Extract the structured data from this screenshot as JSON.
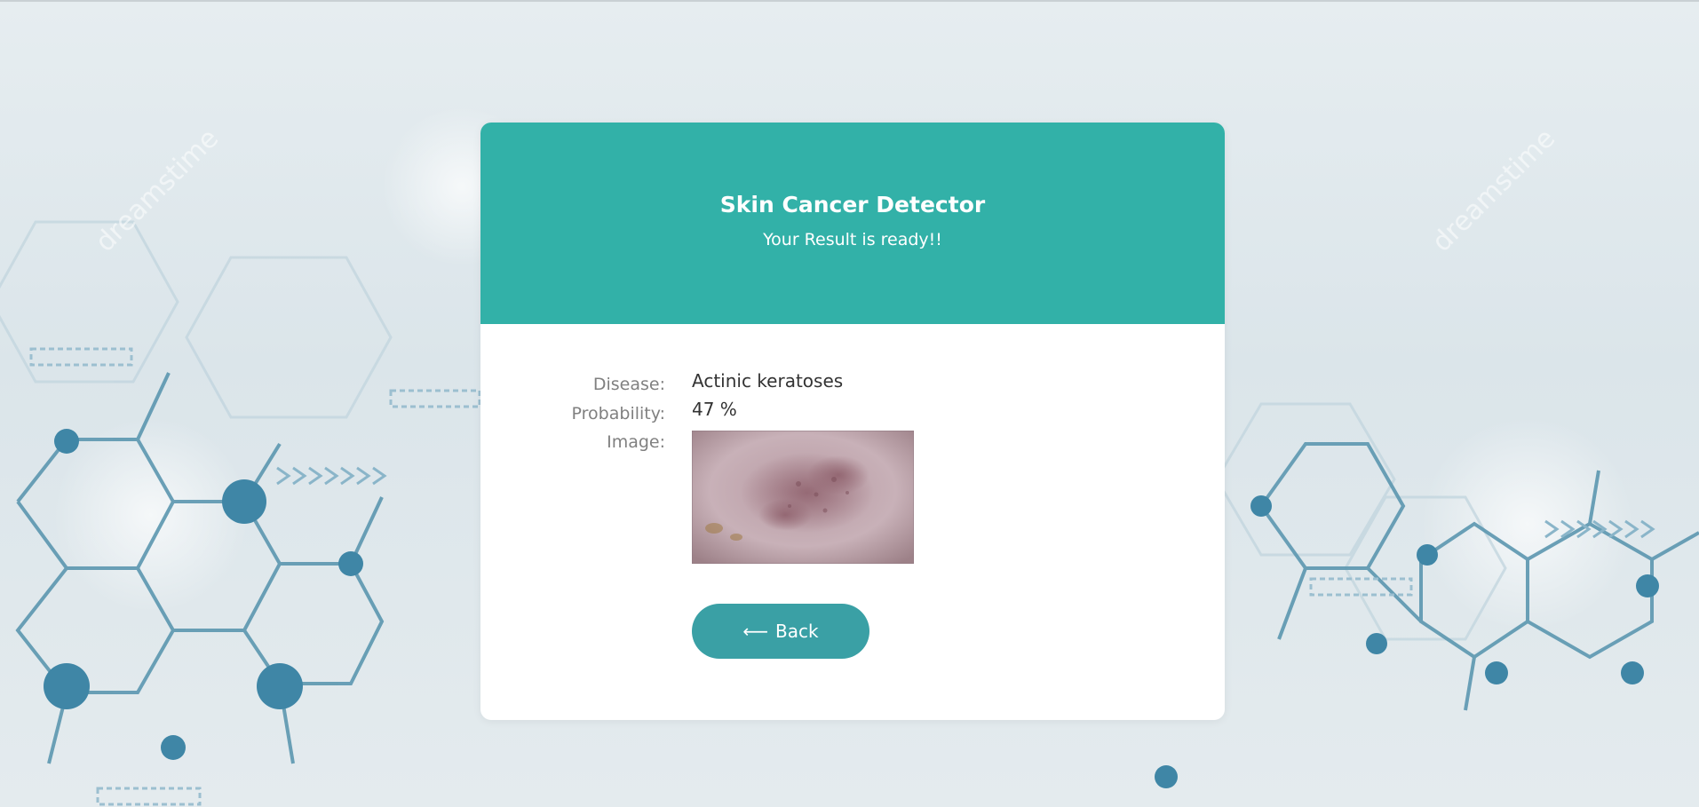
{
  "header": {
    "title": "Skin Cancer Detector",
    "subtitle": "Your Result is ready!!"
  },
  "result": {
    "disease_label": "Disease:",
    "disease_value": "Actinic keratoses",
    "probability_label": "Probability:",
    "probability_value": "47 %",
    "image_label": "Image:"
  },
  "actions": {
    "back_icon": "⟵",
    "back_label": "Back"
  },
  "watermark": "dreamstime",
  "colors": {
    "header_bg": "#32b1a8",
    "button_bg": "#3aa0a5",
    "background": "#e0e8ec"
  },
  "icons": {
    "back": "arrow-left-icon"
  }
}
